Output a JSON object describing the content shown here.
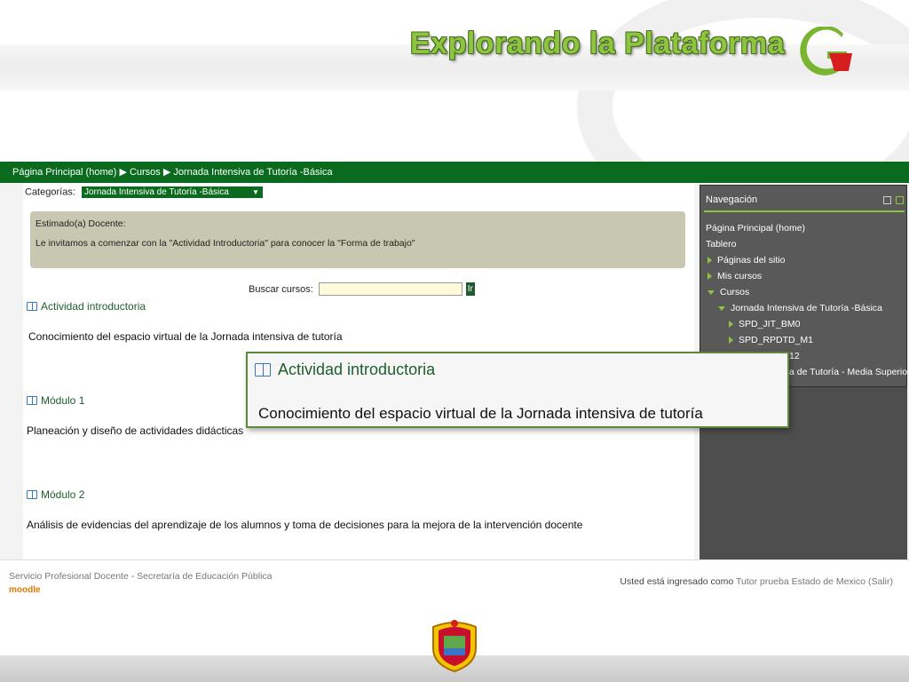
{
  "slide": {
    "title": "Explorando la Plataforma"
  },
  "breadcrumb": {
    "text": "Página Principal (home) ▶ Cursos ▶ Jornada Intensiva de Tutoría -Básica"
  },
  "categories": {
    "label": "Categorías:",
    "selected": "Jornada Intensiva de Tutoría -Básica"
  },
  "notice": {
    "heading": "Estimado(a) Docente:",
    "body": "Le invitamos a comenzar con la \"Actividad Introductoria\" para conocer la \"Forma de trabajo\""
  },
  "search": {
    "label": "Buscar cursos:",
    "value": "",
    "button": "Ir"
  },
  "sections": [
    {
      "title": "Actividad introductoria",
      "description": "Conocimiento del espacio virtual de la Jornada intensiva de tutoría"
    },
    {
      "title": "Módulo 1",
      "description": "Planeación y diseño de actividades didácticas"
    },
    {
      "title": "Módulo 2",
      "description": "Análisis de evidencias del aprendizaje de los alumnos y toma de decisiones para la mejora de la intervención docente"
    }
  ],
  "navigation": {
    "title": "Navegación",
    "items": [
      "Página Principal (home)",
      "Tablero",
      "Páginas del sitio",
      "Mis cursos",
      "Cursos",
      "Jornada Intensiva de Tutoría -Básica",
      "SPD_JIT_BM0",
      "SPD_RPDTD_M1",
      "12",
      "a de Tutoría - Media Superior"
    ]
  },
  "footer": {
    "org": "Servicio Profesional Docente - Secretaría de Educación Pública",
    "logo": "moodle",
    "login_prefix": "Usted está ingresado como",
    "user": "Tutor prueba Estado de Mexico",
    "logout": "(Salir)"
  },
  "zoom": {
    "title": "Actividad introductoria",
    "description": "Conocimiento del espacio virtual de la Jornada intensiva de tutoría"
  },
  "colors": {
    "green_dark": "#0a6b1e",
    "green_light": "#8cc63f",
    "nav_bg": "#595959"
  }
}
